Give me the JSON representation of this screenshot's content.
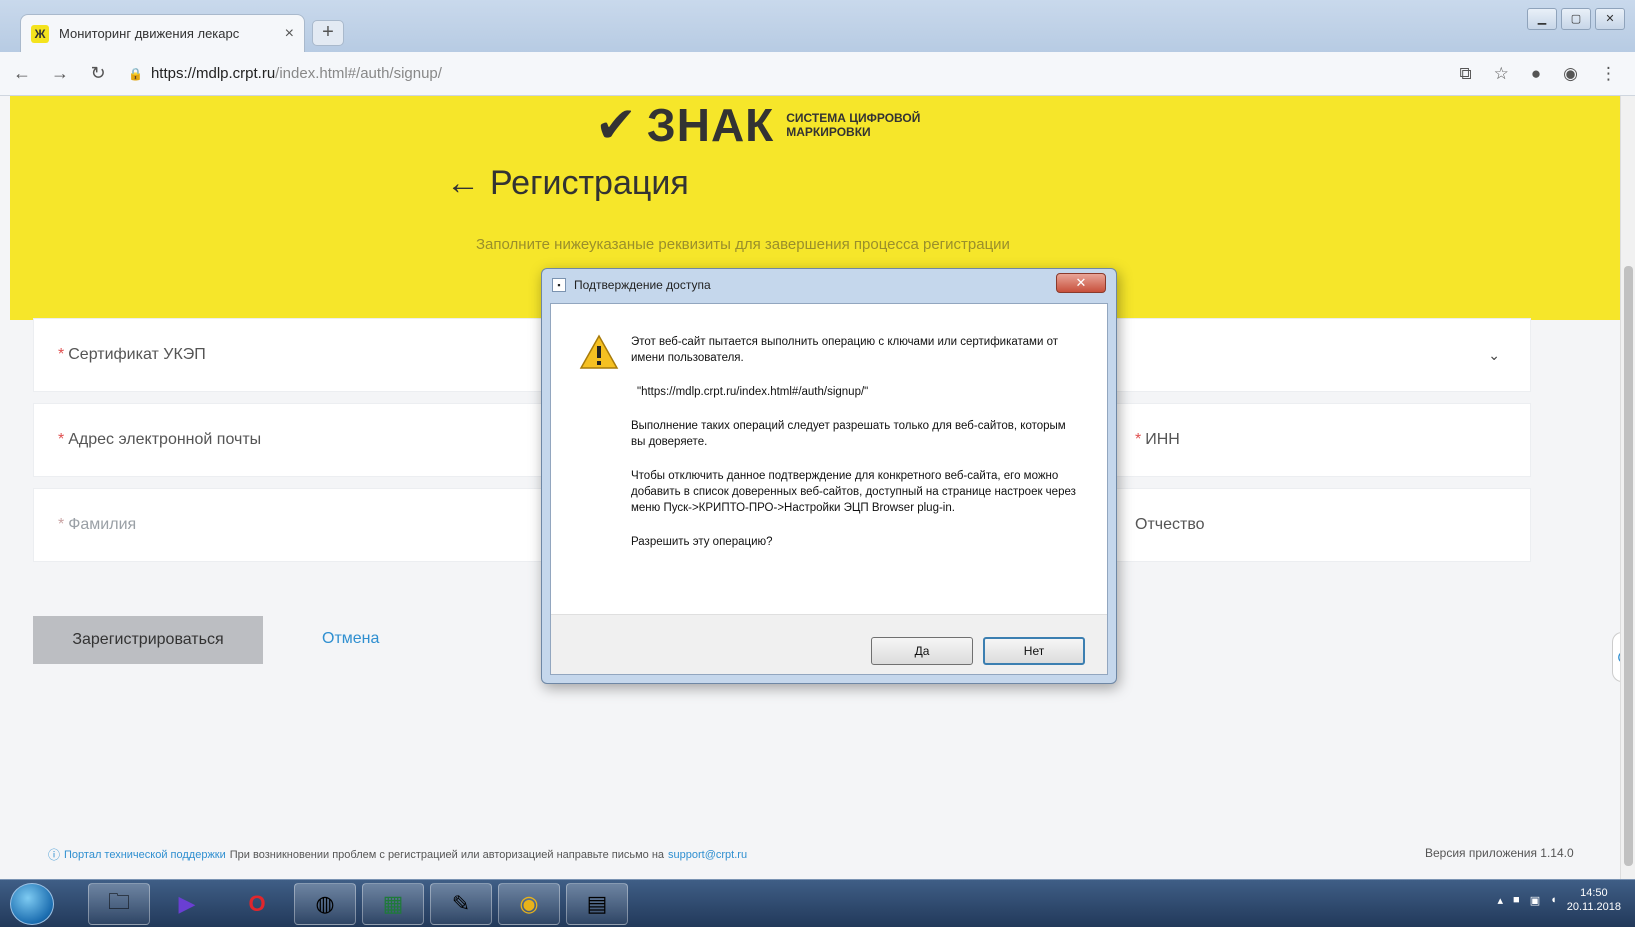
{
  "browser": {
    "tab_title": "Мониторинг движения лекарс",
    "tab_favicon": "Ж",
    "url_host": "https://mdlp.crpt.ru",
    "url_path": "/index.html#/auth/signup/"
  },
  "page": {
    "logo_word": "ЗНАК",
    "logo_subtitle": "СИСТЕМА ЦИФРОВОЙ МАРКИРОВКИ",
    "title": "Регистрация",
    "back_arrow": "←",
    "subtitle": "Заполните нижеуказаные реквизиты для завершения процесса регистрации",
    "fields": {
      "certificate": "Сертификат УКЭП",
      "email": "Адрес электронной почты",
      "inn": "ИНН",
      "surname": "Фамилия",
      "patronymic": "Отчество"
    },
    "register_button": "Зарегистрироваться",
    "cancel_link": "Отмена",
    "footer_link": "Портал технической поддержки",
    "footer_text": "При возникновении проблем с регистрацией или авторизацией направьте письмо на",
    "footer_email": "support@crpt.ru",
    "version": "Версия приложения 1.14.0"
  },
  "dialog": {
    "title": "Подтверждение доступа",
    "line1": "Этот веб-сайт пытается выполнить операцию с ключами или сертификатами от имени пользователя.",
    "url": "\"https://mdlp.crpt.ru/index.html#/auth/signup/\"",
    "line2": "Выполнение таких операций следует разрешать только для веб-сайтов, которым вы доверяете.",
    "line3": "Чтобы отключить данное подтверждение для конкретного веб-сайта, его можно добавить в список доверенных веб-сайтов, доступный на странице настроек через меню Пуск->КРИПТО-ПРО->Настройки ЭЦП Browser plug-in.",
    "question": "Разрешить эту операцию?",
    "yes": "Да",
    "no": "Нет"
  },
  "taskbar": {
    "time": "14:50",
    "date": "20.11.2018"
  },
  "colors": {
    "brand_yellow": "#f6e62a",
    "link_blue": "#2f8fd0",
    "required_red": "#e05050"
  }
}
